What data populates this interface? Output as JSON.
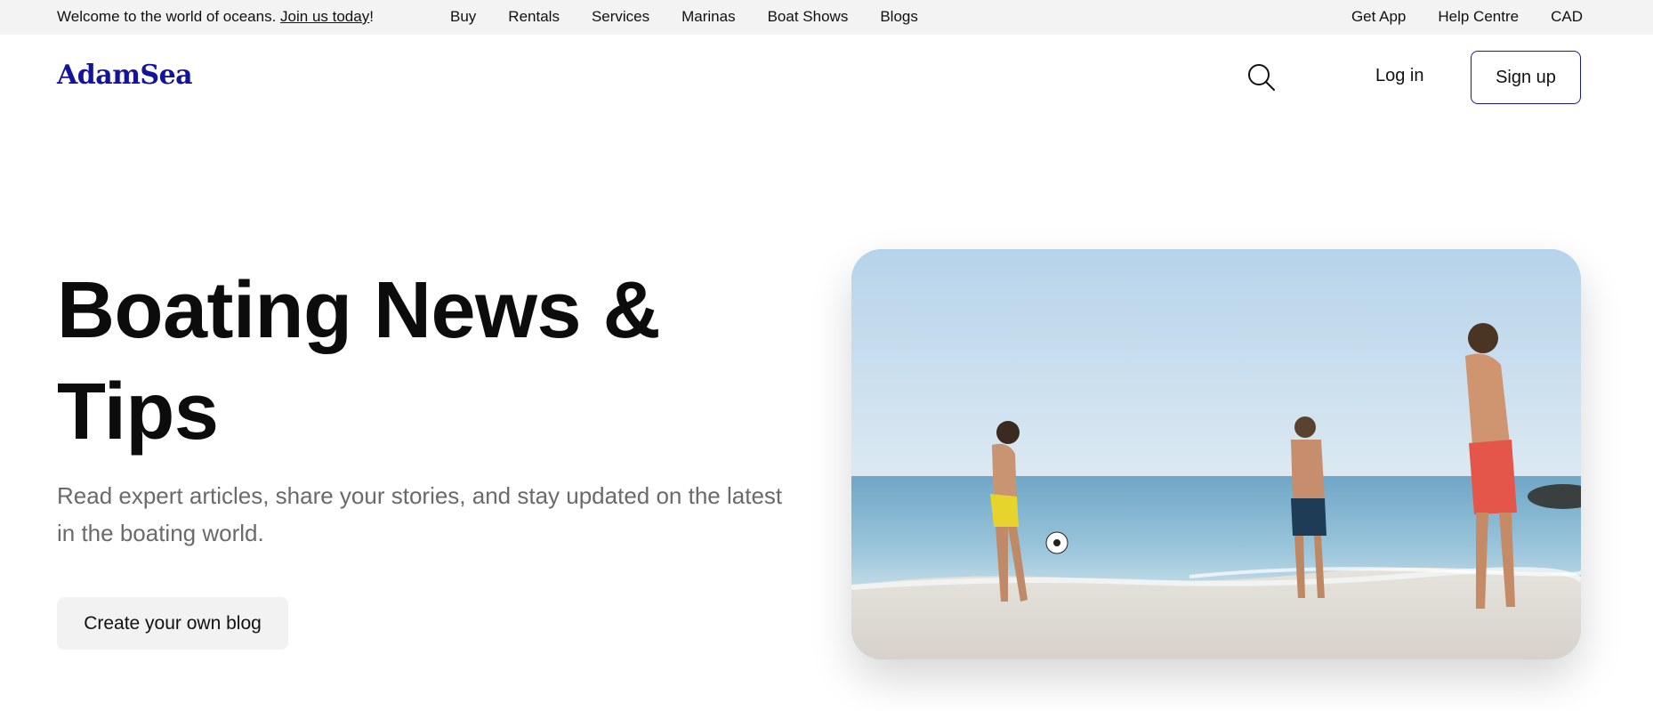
{
  "topbar": {
    "welcome_text": "Welcome to the world of oceans.",
    "join_link": "Join us today",
    "join_suffix": "!",
    "nav": [
      "Buy",
      "Rentals",
      "Services",
      "Marinas",
      "Boat Shows",
      "Blogs"
    ],
    "right": [
      "Get App",
      "Help Centre",
      "CAD"
    ]
  },
  "header": {
    "logo": "AdamSea",
    "search_icon": "search-icon",
    "login_label": "Log in",
    "signup_label": "Sign up",
    "accent_color": "#14149a"
  },
  "hero": {
    "title_line1": "Boating News &",
    "title_line2": "Tips",
    "subtitle": "Read expert articles, share your stories, and stay updated on the latest in the boating world.",
    "cta_label": "Create your own blog",
    "image_alt": "hero-beach-photo"
  }
}
